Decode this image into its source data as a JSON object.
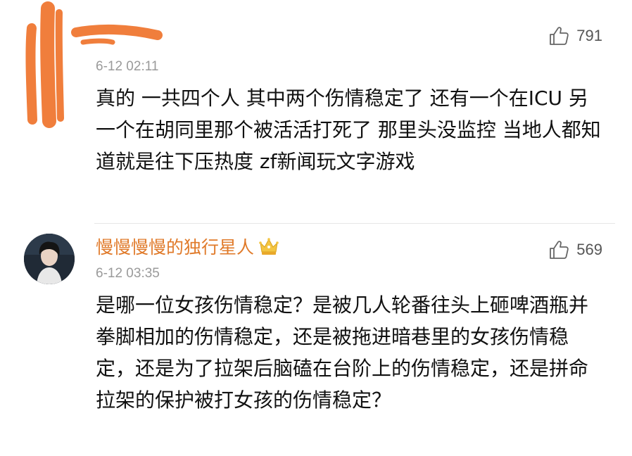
{
  "comments": [
    {
      "time": "6-12 02:11",
      "likes": "791",
      "text": "真的 一共四个人 其中两个伤情稳定了 还有一个在ICU 另一个在胡同里那个被活活打死了 那里头没监控 当地人都知道就是往下压热度 zf新闻玩文字游戏"
    },
    {
      "username": "慢慢慢慢的独行星人",
      "time": "6-12 03:35",
      "likes": "569",
      "text": "是哪一位女孩伤情稳定？是被几人轮番往头上砸啤酒瓶并拳脚相加的伤情稳定，还是被拖进暗巷里的女孩伤情稳定，还是为了拉架后脑磕在台阶上的伤情稳定，还是拼命拉架的保护被打女孩的伤情稳定？"
    }
  ],
  "icons": {
    "like": "thumbs-up-outline-icon",
    "badge": "crown-badge-icon"
  },
  "colors": {
    "username": "#e07a2a",
    "redaction": "#f07e3c",
    "time": "#9a9a9a",
    "text": "#111111"
  }
}
